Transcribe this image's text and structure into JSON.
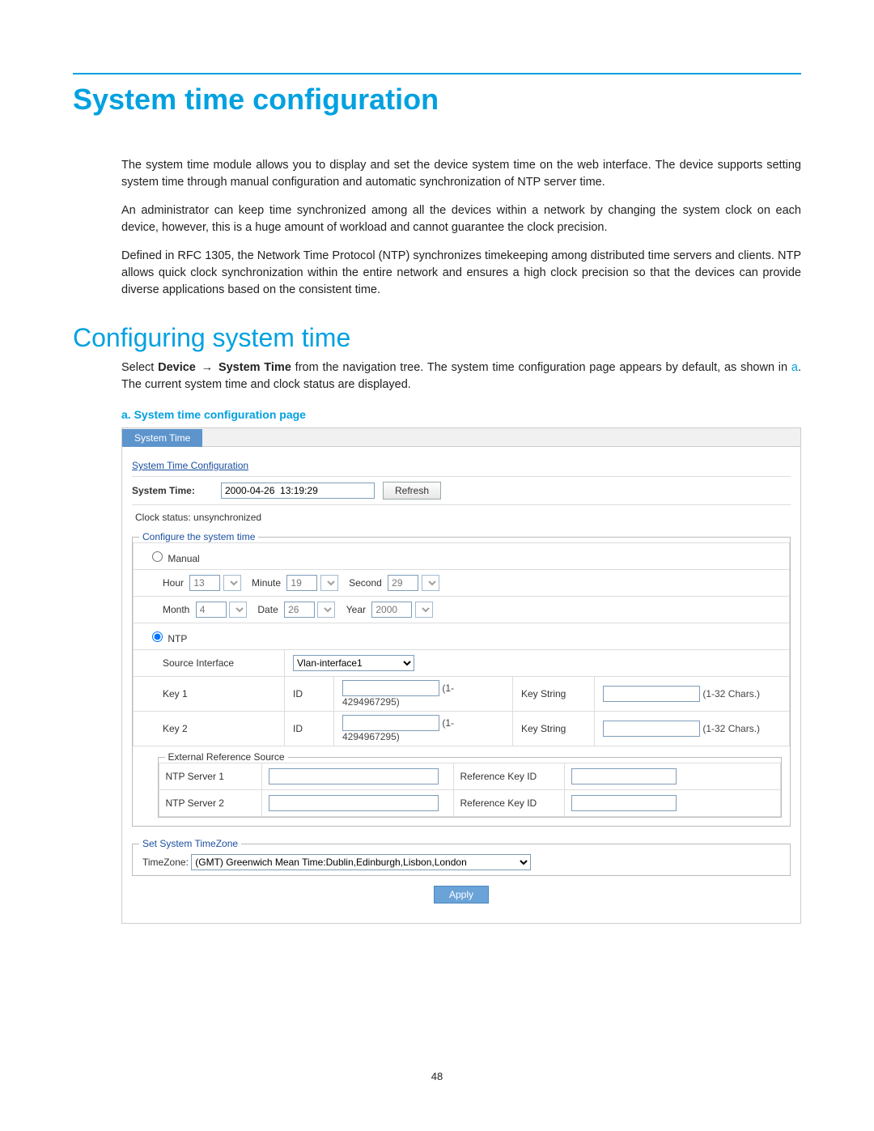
{
  "page_number": "48",
  "title": "System time configuration",
  "paragraphs": {
    "p1": "The system time module allows you to display and set the device system time on the web interface. The device supports setting system time through manual configuration and automatic synchronization of NTP server time.",
    "p2": "An administrator can keep time synchronized among all the devices within a network by changing the system clock on each device, however, this is a huge amount of workload and cannot guarantee the clock precision.",
    "p3": "Defined in RFC 1305, the Network Time Protocol (NTP) synchronizes timekeeping among distributed time servers and clients. NTP allows quick clock synchronization within the entire network and ensures a high clock precision so that the devices can provide diverse applications based on the consistent time."
  },
  "subheading": "Configuring system time",
  "select_line": {
    "prefix": "Select ",
    "device": "Device",
    "system_time": "System Time",
    "tail": " from the navigation tree. The system time configuration page appears by default, as shown in ",
    "ref": "a",
    "end": ". The current system time and clock status are displayed."
  },
  "caption": "a.   System time configuration page",
  "screenshot": {
    "tab": "System Time",
    "section_title": "System Time Configuration",
    "system_time_label": "System Time:",
    "system_time_value": "2000-04-26  13:19:29",
    "refresh_btn": "Refresh",
    "clock_status": "Clock status: unsynchronized",
    "configure_legend": "Configure the system time",
    "manual_label": "Manual",
    "ntp_label": "NTP",
    "time_labels": {
      "hour": "Hour",
      "minute": "Minute",
      "second": "Second",
      "month": "Month",
      "date": "Date",
      "year": "Year"
    },
    "time_values": {
      "hour": "13",
      "minute": "19",
      "second": "29",
      "month": "4",
      "date": "26",
      "year": "2000"
    },
    "source_iface_label": "Source Interface",
    "source_iface_value": "Vlan-interface1",
    "key1_label": "Key 1",
    "key2_label": "Key 2",
    "id_label": "ID",
    "id_range": "(1-4294967295)",
    "keystring_label": "Key String",
    "keystring_range": "(1-32 Chars.)",
    "ext_legend": "External Reference Source",
    "ntp_server1_label": "NTP Server 1",
    "ntp_server2_label": "NTP Server 2",
    "ref_key_label": "Reference Key ID",
    "tz_legend": "Set System TimeZone",
    "tz_label": "TimeZone:",
    "tz_value": "(GMT) Greenwich Mean Time:Dublin,Edinburgh,Lisbon,London",
    "apply_btn": "Apply"
  }
}
